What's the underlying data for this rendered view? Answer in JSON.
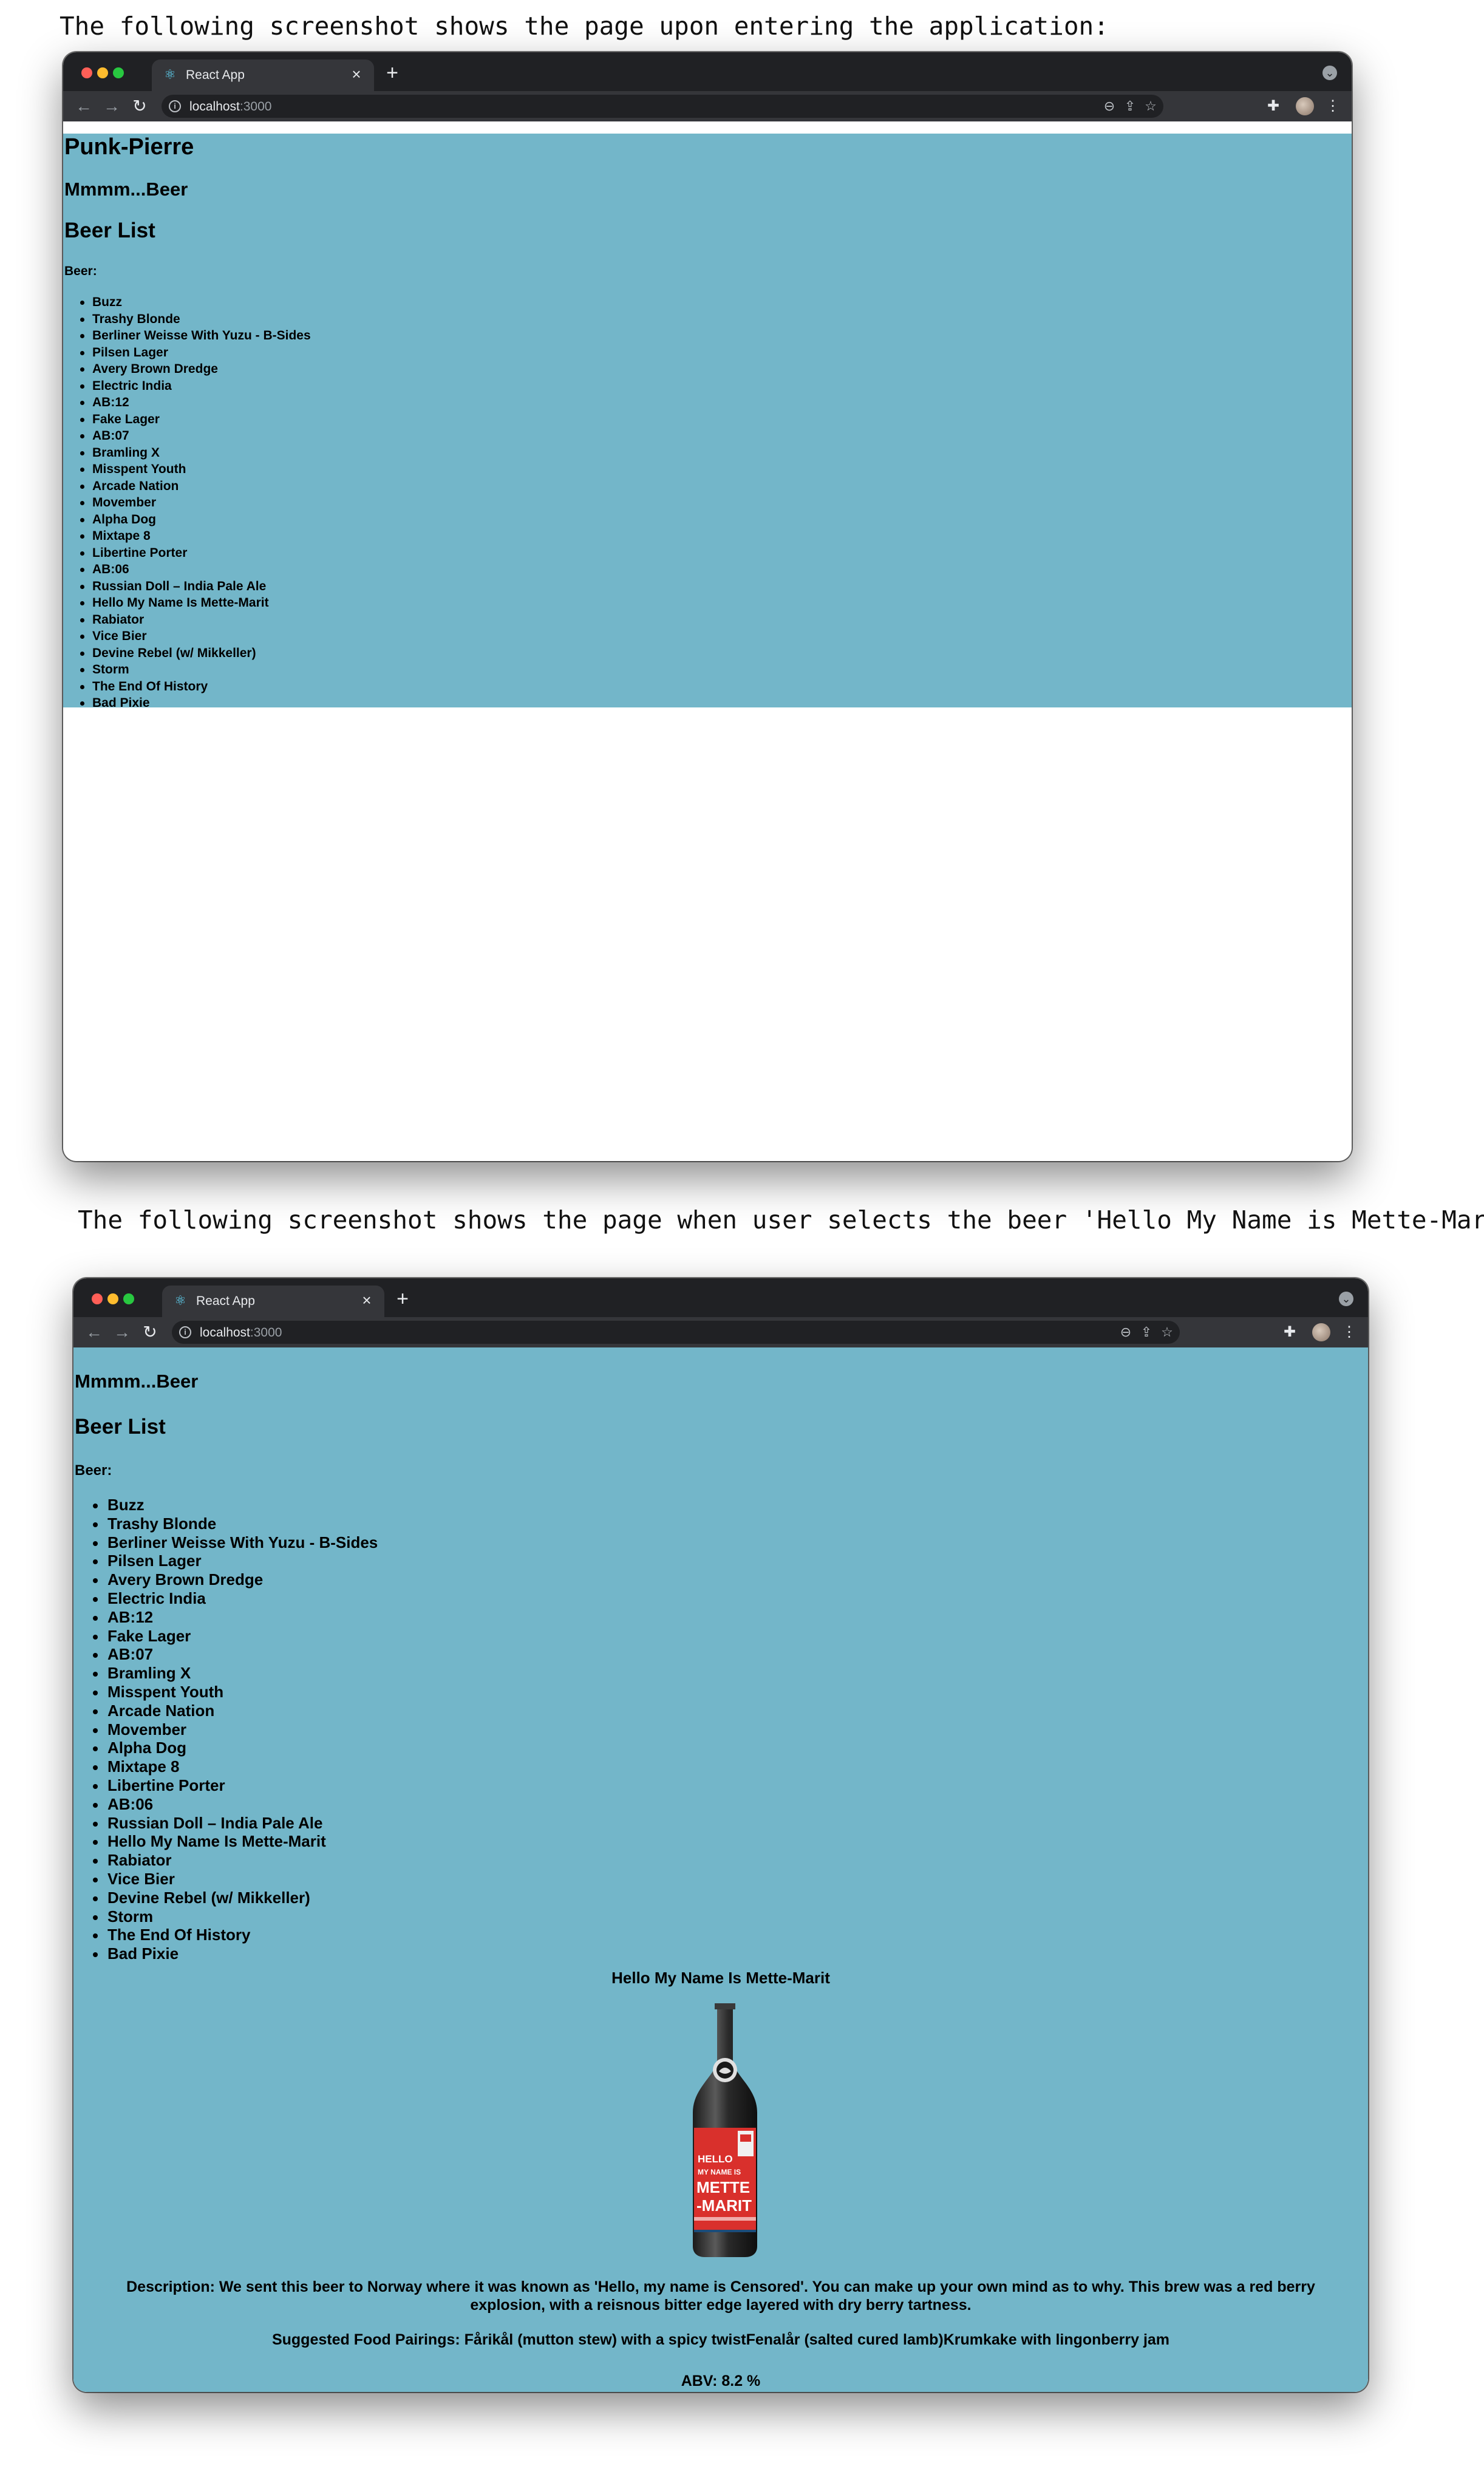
{
  "captions": {
    "first": "The following screenshot shows the page upon entering the application:",
    "second": "The following screenshot shows the page when user selects the beer 'Hello My Name is Mette-Marit':"
  },
  "browser": {
    "tab_title": "React App",
    "url_host": "localhost",
    "url_port": ":3000"
  },
  "app": {
    "title": "Punk-Pierre",
    "tagline": "Mmmm...Beer",
    "list_heading": "Beer List",
    "list_label": "Beer:",
    "beers": [
      "Buzz",
      "Trashy Blonde",
      "Berliner Weisse With Yuzu - B-Sides",
      "Pilsen Lager",
      "Avery Brown Dredge",
      "Electric India",
      "AB:12",
      "Fake Lager",
      "AB:07",
      "Bramling X",
      "Misspent Youth",
      "Arcade Nation",
      "Movember",
      "Alpha Dog",
      "Mixtape 8",
      "Libertine Porter",
      "AB:06",
      "Russian Doll – India Pale Ale",
      "Hello My Name Is Mette-Marit",
      "Rabiator",
      "Vice Bier",
      "Devine Rebel (w/ Mikkeller)",
      "Storm",
      "The End Of History",
      "Bad Pixie"
    ]
  },
  "selected_beer": {
    "name": "Hello My Name Is Mette-Marit",
    "label_lines": [
      "HELLO",
      "MY NAME IS",
      "METTE",
      "-MARIT"
    ],
    "description": "Description: We sent this beer to Norway where it was known as 'Hello, my name is Censored'. You can make up your own mind as to why. This brew was a red berry explosion, with a reisnous bitter edge layered with dry berry tartness.",
    "food_pairings": "Suggested Food Pairings: Fårikål (mutton stew) with a spicy twistFenalår (salted cured lamb)Krumkake with lingonberry jam",
    "abv": "ABV: 8.2 %"
  },
  "colors": {
    "app_background": "#73b6c9",
    "browser_frame": "#202124",
    "browser_toolbar": "#35363a",
    "bottle_label": "#d9302c"
  },
  "icons": {
    "tab_favicon": "react-atom-icon",
    "close": "close-icon",
    "new_tab": "plus-icon",
    "back": "arrow-left-icon",
    "forward": "arrow-right-icon",
    "reload": "reload-icon",
    "site_info": "info-icon",
    "zoom": "zoom-icon",
    "share": "share-icon",
    "bookmark": "star-icon",
    "extensions": "puzzle-icon",
    "menu": "kebab-menu-icon"
  }
}
